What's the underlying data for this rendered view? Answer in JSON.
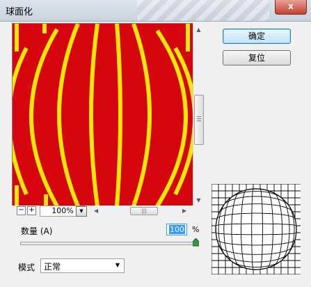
{
  "window": {
    "title": "球面化",
    "close_glyph": "x"
  },
  "buttons": {
    "ok": "确定",
    "reset": "复位"
  },
  "zoom": {
    "minus": "−",
    "plus": "+",
    "value": "100%",
    "dropdown_glyph": "▼"
  },
  "amount": {
    "label": "数量 (A)",
    "value": "100",
    "unit": "%",
    "level": 100
  },
  "mode": {
    "label": "模式",
    "selected": "正常",
    "dropdown_glyph": "▼"
  },
  "icons": [
    "close-icon",
    "zoom-out-icon",
    "zoom-in-icon",
    "chevron-down-icon",
    "scroll-up-icon",
    "scroll-down-icon",
    "scroll-left-icon",
    "scroll-right-icon"
  ],
  "colors": {
    "preview_red": "#d6040c",
    "preview_yellow": "#ffe800",
    "accent": "#3399ff",
    "close": "#c4412d"
  }
}
